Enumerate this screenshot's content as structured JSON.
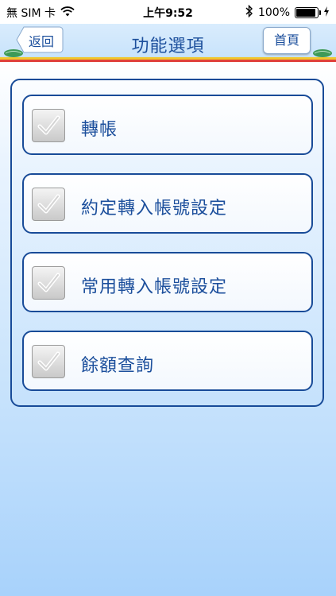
{
  "status_bar": {
    "carrier": "無 SIM 卡",
    "time": "上午9:52",
    "battery": "100%"
  },
  "nav": {
    "back_label": "返回",
    "title": "功能選項",
    "home_label": "首頁"
  },
  "menu": {
    "items": [
      {
        "label": "轉帳",
        "checked": true
      },
      {
        "label": "約定轉入帳號設定",
        "checked": true
      },
      {
        "label": "常用轉入帳號設定",
        "checked": true
      },
      {
        "label": "餘額查詢",
        "checked": true
      }
    ]
  },
  "colors": {
    "accent": "#1c4f9c",
    "border": "#184b98",
    "stripe_yellow": "#f0c62e",
    "stripe_red": "#e0413a"
  }
}
